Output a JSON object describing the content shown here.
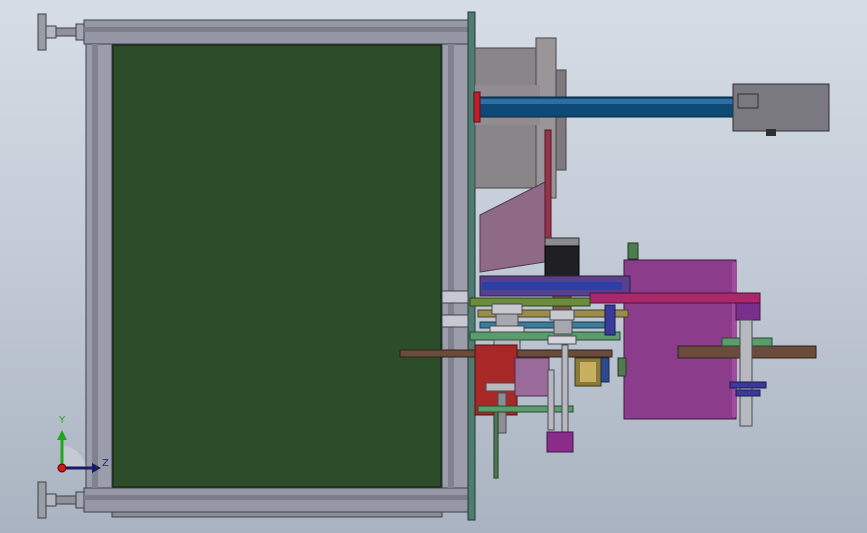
{
  "axis_triad": {
    "y_label": "Y",
    "z_label": "Z",
    "y_color": "#1fa81f",
    "z_color": "#1a1ad6",
    "origin_color": "#d01818"
  },
  "colors": {
    "frame": "#8c8f9e",
    "frame_dark": "#4a4c58",
    "panel": "#2b4d2a",
    "plate": "#4f7c70",
    "drum": "#8a8588",
    "shaft": "#0d4a78",
    "motor_box": "#7a7980",
    "gearbox": "#8b3c8b",
    "slide": "#6b4a72",
    "rail_brown": "#6a4b3c"
  }
}
